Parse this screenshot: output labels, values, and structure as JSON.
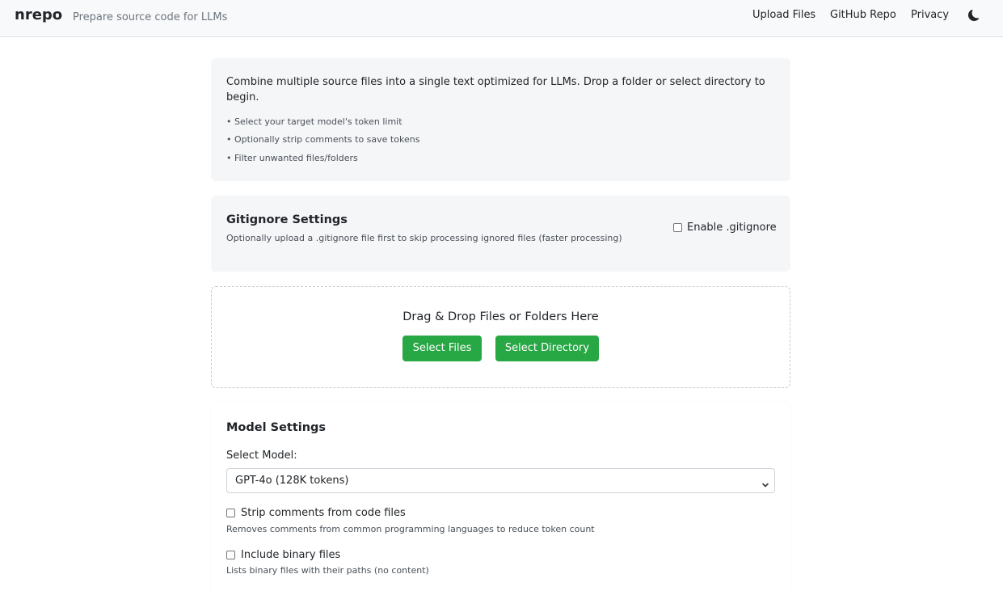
{
  "header": {
    "brand": "nrepo",
    "tagline": "Prepare source code for LLMs",
    "nav": [
      "Upload Files",
      "GitHub Repo",
      "Privacy"
    ],
    "theme_icon": "moon-icon"
  },
  "intro": {
    "text": "Combine multiple source files into a single text optimized for LLMs. Drop a folder or select directory to begin.",
    "bullets": [
      "• Select your target model's token limit",
      "• Optionally strip comments to save tokens",
      "• Filter unwanted files/folders"
    ]
  },
  "gitignore": {
    "title": "Gitignore Settings",
    "description": "Optionally upload a .gitignore file first to skip processing ignored files (faster processing)",
    "checkbox_label": "Enable .gitignore",
    "checked": false
  },
  "dropzone": {
    "title": "Drag & Drop Files or Folders Here",
    "select_files": "Select Files",
    "select_directory": "Select Directory",
    "button_color": "#28a745"
  },
  "model_settings": {
    "title": "Model Settings",
    "select_label": "Select Model:",
    "selected_model": "GPT-4o (128K tokens)",
    "strip_comments": {
      "label": "Strip comments from code files",
      "description": "Removes comments from common programming languages to reduce token count",
      "checked": false
    },
    "include_binary": {
      "label": "Include binary files",
      "description": "Lists binary files with their paths (no content)",
      "checked": false
    }
  }
}
